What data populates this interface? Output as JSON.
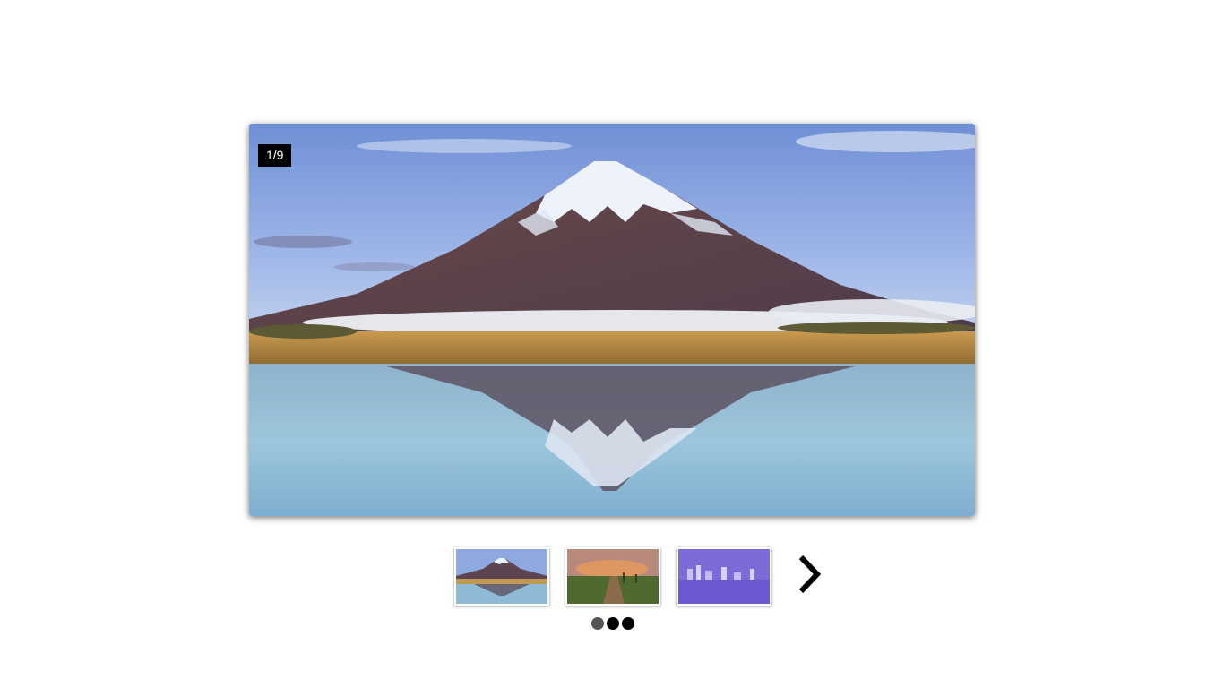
{
  "slider": {
    "counter": "1/9",
    "current_slide": 1,
    "total_slides": 9,
    "main_image": "snow-capped-mountain-reflection-lake",
    "thumbnails": [
      {
        "image": "mountain-reflection-thumbnail",
        "active": true
      },
      {
        "image": "sunset-boardwalk-thumbnail",
        "active": false
      },
      {
        "image": "city-skyline-purple-thumbnail",
        "active": false
      }
    ],
    "next_icon": "chevron-right-icon",
    "pagination_dots": [
      {
        "active": true
      },
      {
        "active": false
      },
      {
        "active": false
      }
    ]
  },
  "colors": {
    "counter_bg": "#000000",
    "counter_text": "#ffffff",
    "dot_active": "#555555",
    "dot_inactive": "#000000"
  }
}
